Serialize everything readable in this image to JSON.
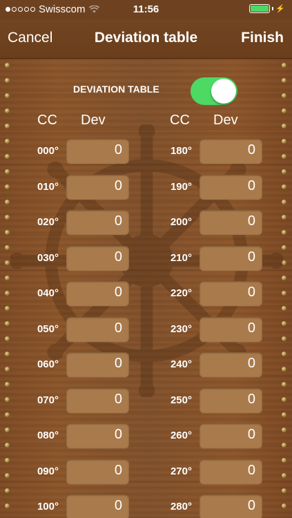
{
  "status_bar": {
    "carrier": "Swisscom",
    "time": "11:56",
    "signal_bars_filled": 1,
    "signal_bars_total": 5,
    "battery_level": 1.0,
    "battery_color": "#4cd964",
    "wifi_icon": "wifi-icon",
    "charging_icon": "bolt-icon"
  },
  "navbar": {
    "cancel_label": "Cancel",
    "title": "Deviation table",
    "finish_label": "Finish"
  },
  "deviation_toggle": {
    "label": "DEVIATION TABLE",
    "enabled": true,
    "accent_color": "#4cd964"
  },
  "columns": {
    "left": {
      "cc_header": "CC",
      "dev_header": "Dev"
    },
    "right": {
      "cc_header": "CC",
      "dev_header": "Dev"
    }
  },
  "rows": [
    {
      "left": {
        "course": "000°",
        "deviation": "0"
      },
      "right": {
        "course": "180°",
        "deviation": "0"
      }
    },
    {
      "left": {
        "course": "010°",
        "deviation": "0"
      },
      "right": {
        "course": "190°",
        "deviation": "0"
      }
    },
    {
      "left": {
        "course": "020°",
        "deviation": "0"
      },
      "right": {
        "course": "200°",
        "deviation": "0"
      }
    },
    {
      "left": {
        "course": "030°",
        "deviation": "0"
      },
      "right": {
        "course": "210°",
        "deviation": "0"
      }
    },
    {
      "left": {
        "course": "040°",
        "deviation": "0"
      },
      "right": {
        "course": "220°",
        "deviation": "0"
      }
    },
    {
      "left": {
        "course": "050°",
        "deviation": "0"
      },
      "right": {
        "course": "230°",
        "deviation": "0"
      }
    },
    {
      "left": {
        "course": "060°",
        "deviation": "0"
      },
      "right": {
        "course": "240°",
        "deviation": "0"
      }
    },
    {
      "left": {
        "course": "070°",
        "deviation": "0"
      },
      "right": {
        "course": "250°",
        "deviation": "0"
      }
    },
    {
      "left": {
        "course": "080°",
        "deviation": "0"
      },
      "right": {
        "course": "260°",
        "deviation": "0"
      }
    },
    {
      "left": {
        "course": "090°",
        "deviation": "0"
      },
      "right": {
        "course": "270°",
        "deviation": "0"
      }
    },
    {
      "left": {
        "course": "100°",
        "deviation": "0"
      },
      "right": {
        "course": "280°",
        "deviation": "0"
      }
    }
  ],
  "background_icon": "ship-wheel-icon"
}
